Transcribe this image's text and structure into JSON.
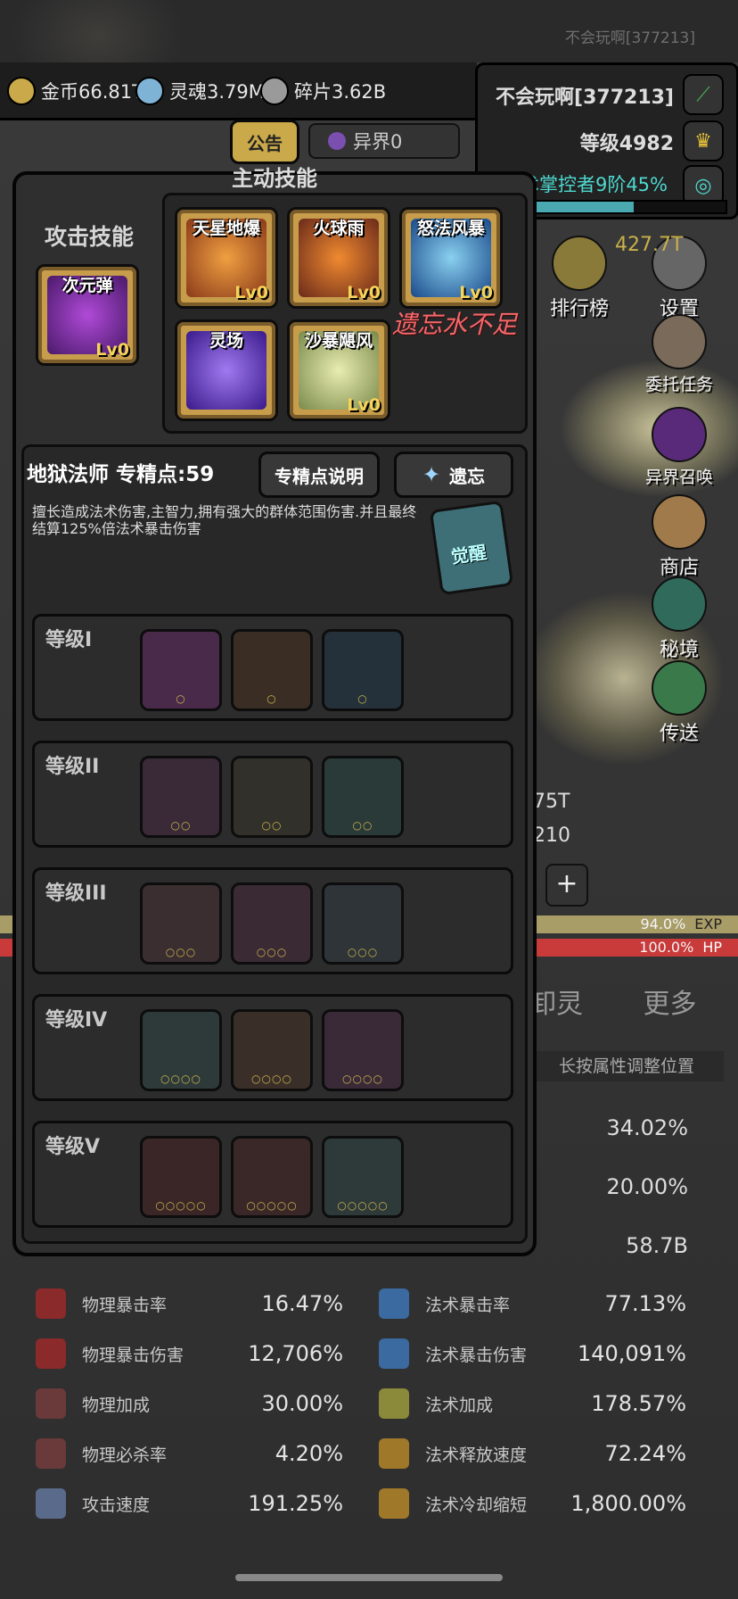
{
  "top": {
    "player_id_small": "不会玩啊[377213]"
  },
  "resources": [
    {
      "label": "金币66.81T",
      "icon": "gold-coin-icon",
      "color": "#c9a94a"
    },
    {
      "label": "灵魂3.79M",
      "icon": "soul-icon",
      "color": "#7fb3d6"
    },
    {
      "label": "碎片3.62B",
      "icon": "shard-icon",
      "color": "#9a9a9a"
    }
  ],
  "player": {
    "name": "不会玩啊[377213]",
    "level": "等级4982",
    "title": "法术掌控者9阶45%"
  },
  "notice_button": "公告",
  "otherworld": "异界0",
  "side_menu": [
    {
      "label": "排行榜",
      "icon": "trophy-icon"
    },
    {
      "label": "设置",
      "icon": "gear-icon"
    },
    {
      "label": "委托任务",
      "icon": "quest-icon"
    },
    {
      "label": "异界召唤",
      "icon": "vortex-icon"
    },
    {
      "label": "商店",
      "icon": "shop-icon"
    },
    {
      "label": "秘境",
      "icon": "portal-icon"
    },
    {
      "label": "传送",
      "icon": "horn-icon"
    }
  ],
  "bg_numbers": {
    "a": "427.7T",
    "b": "75T",
    "c": "210"
  },
  "bars": {
    "exp_pct": "94.0%",
    "exp_label": "EXP",
    "hp_pct": "100.0%",
    "hp_label": "HP"
  },
  "bottom_tabs": {
    "t1": "卸灵",
    "t2": "更多"
  },
  "hint": "长按属性调整位置",
  "right_values": [
    "34.02%",
    "20.00%",
    "58.7B"
  ],
  "popup": {
    "active_title": "主动技能",
    "attack_label": "攻击技能",
    "attack_skill": {
      "name": "次元弹",
      "lv": "Lv0",
      "color": "#7a2fa0"
    },
    "active_skills": [
      {
        "name": "天星地爆",
        "lv": "Lv0",
        "color": "#d86a2a"
      },
      {
        "name": "火球雨",
        "lv": "Lv0",
        "color": "#c8722a"
      },
      {
        "name": "怒法风暴",
        "lv": "Lv0",
        "color": "#2a6ab8"
      },
      {
        "name": "灵场",
        "lv": "",
        "color": "#5b2ab0"
      },
      {
        "name": "沙暴飓风",
        "lv": "Lv0",
        "color": "#b7c47a"
      }
    ],
    "warning": "遗忘水不足",
    "spec_title": "地狱法师 专精点:59",
    "spec_button": "专精点说明",
    "forget_button": "遗忘",
    "desc": "擅长造成法术伤害,主智力,拥有强大的群体范围伤害.并且最终结算125%倍法术暴击伤害",
    "awaken_label": "觉醒",
    "tiers": [
      {
        "name": "等级I",
        "dots": "○",
        "slots": [
          "#4a2a4a",
          "#3a2e24",
          "#24303a"
        ]
      },
      {
        "name": "等级II",
        "dots": "○○",
        "slots": [
          "#3a2a38",
          "#32302a",
          "#2a3a38"
        ]
      },
      {
        "name": "等级III",
        "dots": "○○○",
        "slots": [
          "#3a2e30",
          "#3a2a34",
          "#2e3438"
        ]
      },
      {
        "name": "等级IV",
        "dots": "○○○○",
        "slots": [
          "#2e3a3a",
          "#3a2e28",
          "#3a2a38"
        ]
      },
      {
        "name": "等级V",
        "dots": "○○○○○",
        "slots": [
          "#3a2626",
          "#3a2828",
          "#2e3a3a"
        ]
      }
    ]
  },
  "stats": [
    {
      "l_name": "物理暴击率",
      "l_val": "16.47%",
      "r_name": "法术暴击率",
      "r_val": "77.13%"
    },
    {
      "l_name": "物理暴击伤害",
      "l_val": "12,706%",
      "r_name": "法术暴击伤害",
      "r_val": "140,091%"
    },
    {
      "l_name": "物理加成",
      "l_val": "30.00%",
      "r_name": "法术加成",
      "r_val": "178.57%"
    },
    {
      "l_name": "物理必杀率",
      "l_val": "4.20%",
      "r_name": "法术释放速度",
      "r_val": "72.24%"
    },
    {
      "l_name": "攻击速度",
      "l_val": "191.25%",
      "r_name": "法术冷却缩短",
      "r_val": "1,800.00%"
    }
  ]
}
